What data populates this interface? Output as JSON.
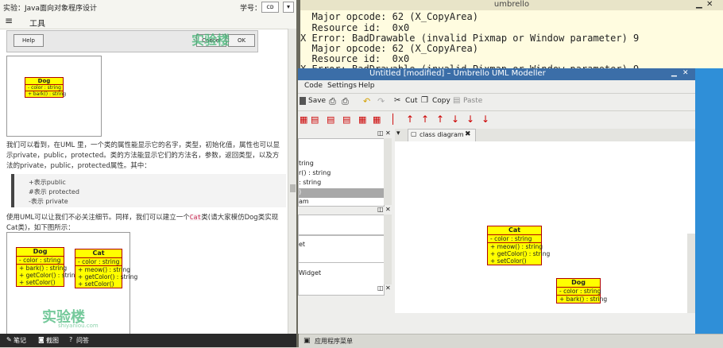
{
  "left_pane": {
    "title": "实验：Java面向对象程序设计",
    "student_label": "学号：",
    "student_select": "ᴄᴅ",
    "menu_toggle": "≡",
    "menu_tools": "工具",
    "help_button": "Help",
    "cancel_button": "Cancel",
    "ok_button": "OK",
    "watermark_top": "实验楼",
    "para1": "我们可以看到，在UML 里，一个类的属性能显示它的名字，类型，初始化值，属性也可以显示private，public，protected。类的方法能显示它们的方法名，参数，返回类型，以及方法的private，public，protected属性。其中：",
    "bullets": [
      "+表示public",
      "#表示 protected",
      "-表示 private"
    ],
    "para2_a": "使用UML可以让我们不必关注细节。同样，我们可以建立一个",
    "para2_code": "Cat",
    "para2_b": "类(请大家模仿Dog类实现Cat类)，如下图所示：",
    "watermark_bottom": "实验楼",
    "watermark_sub": "shiyanlou.com",
    "dog_small": {
      "name": "Dog",
      "attrs": [
        "- color : string"
      ],
      "ops": [
        "+ bark() : string"
      ]
    },
    "dog_img2": {
      "name": "Dog",
      "attrs": [
        "- color : string"
      ],
      "ops": [
        "+ bark() : string",
        "+ getColor() : string",
        "+ setColor()"
      ]
    },
    "cat_img2": {
      "name": "Cat",
      "attrs": [
        "- color : string"
      ],
      "ops": [
        "+ meow() : string",
        "+ getColor() : string",
        "+ setColor()"
      ]
    }
  },
  "bottom_bar": {
    "notes": "笔记",
    "screenshot": "截图",
    "qa": "问答"
  },
  "terminal": {
    "title": "umbrello",
    "lines": [
      "  Major opcode: 62 (X_CopyArea)",
      "  Resource id:  0x0",
      "X Error: BadDrawable (invalid Pixmap or Window parameter) 9",
      "  Major opcode: 62 (X_CopyArea)",
      "  Resource id:  0x0",
      "X Error: BadDrawable (invalid Pixmap or Window parameter) 9"
    ]
  },
  "umbrello": {
    "title": "Untitled [modified] – Umbrello UML Modeller",
    "menu": [
      "Code",
      "Settings",
      "Help"
    ],
    "toolbar": {
      "save": "Save",
      "cut": "Cut",
      "copy": "Copy",
      "paste": "Paste"
    },
    "tab_label": "class diagram",
    "tree_items": [
      "tring",
      "r() : string",
      ": string",
      ")",
      "am"
    ],
    "tree2_items": [
      "et",
      "Widget"
    ],
    "cat": {
      "name": "Cat",
      "attrs": [
        "- color : string"
      ],
      "ops": [
        "+ meow() : string",
        "+ getColor() : string",
        "+ setColor()"
      ]
    },
    "dog": {
      "name": "Dog",
      "attrs": [
        "- color : string"
      ],
      "ops": [
        "+ bark() : string"
      ]
    }
  },
  "taskbar": {
    "app_menu": "应用程序菜单"
  },
  "colors": {
    "uml_fill": "#ffff00",
    "uml_border": "#b00000",
    "title_blue": "#3b6ea8",
    "terminal_bg": "#fffce0",
    "desktop": "#2f8fd8"
  }
}
